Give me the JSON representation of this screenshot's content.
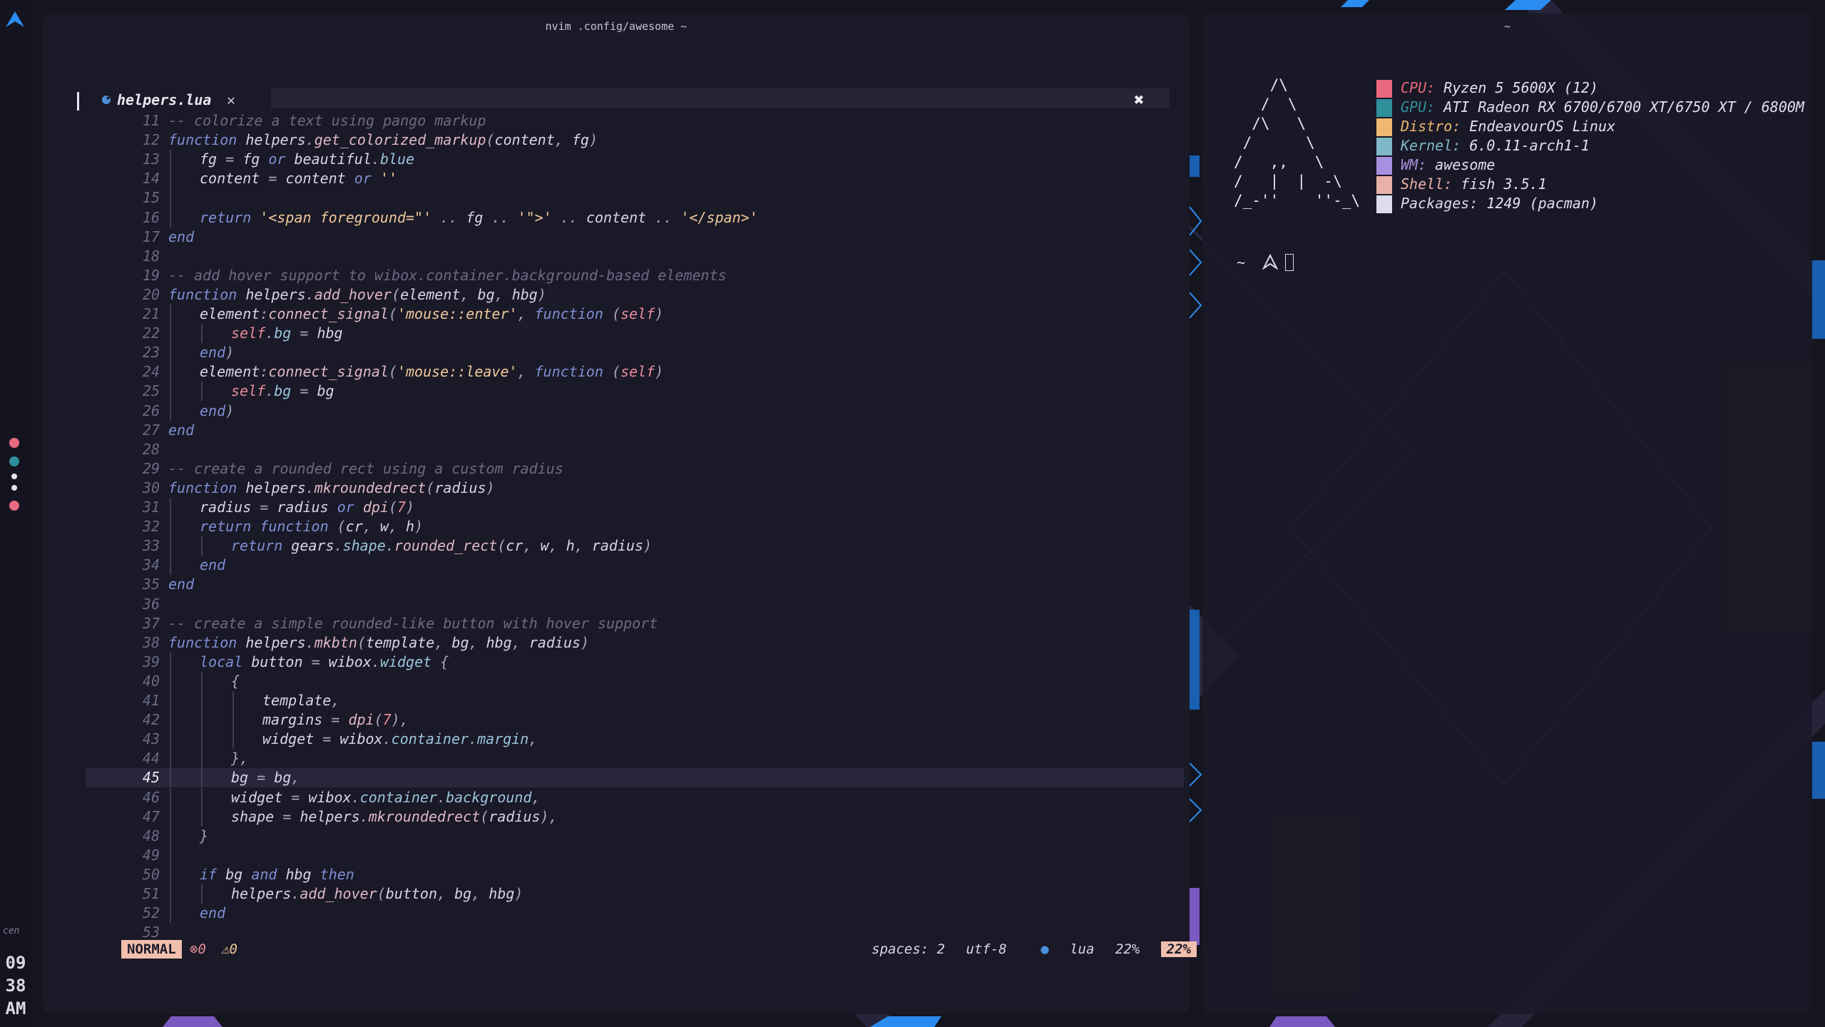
{
  "palette": {
    "accent": "#2a8cf0",
    "pink": "#e8697f",
    "teal": "#2f8f9b",
    "peach": "#f0bfae",
    "purple": "#a27be0"
  },
  "editor": {
    "title": "nvim .config/awesome ~",
    "tab_name": "helpers.lua",
    "tab_close": "✕",
    "close_all": "✖",
    "lines": [
      {
        "n": "11",
        "code": "-- colorize a text using pango markup",
        "kind": "comment",
        "indent": 0
      },
      {
        "n": "12",
        "code": "function helpers.get_colorized_markup(content, fg)",
        "kind": "fn",
        "indent": 0
      },
      {
        "n": "13",
        "code": "fg = fg or beautiful.blue",
        "kind": "code",
        "indent": 1
      },
      {
        "n": "14",
        "code": "content = content or ''",
        "kind": "code",
        "indent": 1
      },
      {
        "n": "15",
        "code": "",
        "kind": "code",
        "indent": 1
      },
      {
        "n": "16",
        "code": "return '<span foreground=\"' .. fg .. '\">' .. content .. '</span>'",
        "kind": "ret",
        "indent": 1
      },
      {
        "n": "17",
        "code": "end",
        "kind": "kw",
        "indent": 0
      },
      {
        "n": "18",
        "code": "",
        "kind": "code",
        "indent": 0
      },
      {
        "n": "19",
        "code": "-- add hover support to wibox.container.background-based elements",
        "kind": "comment",
        "indent": 0
      },
      {
        "n": "20",
        "code": "function helpers.add_hover(element, bg, hbg)",
        "kind": "fn",
        "indent": 0
      },
      {
        "n": "21",
        "code": "element:connect_signal('mouse::enter', function (self)",
        "kind": "sig",
        "indent": 1
      },
      {
        "n": "22",
        "code": "self.bg = hbg",
        "kind": "self",
        "indent": 2
      },
      {
        "n": "23",
        "code": "end)",
        "kind": "kw",
        "indent": 1
      },
      {
        "n": "24",
        "code": "element:connect_signal('mouse::leave', function (self)",
        "kind": "sig",
        "indent": 1
      },
      {
        "n": "25",
        "code": "self.bg = bg",
        "kind": "self",
        "indent": 2
      },
      {
        "n": "26",
        "code": "end)",
        "kind": "kw",
        "indent": 1
      },
      {
        "n": "27",
        "code": "end",
        "kind": "kw",
        "indent": 0
      },
      {
        "n": "28",
        "code": "",
        "kind": "code",
        "indent": 0
      },
      {
        "n": "29",
        "code": "-- create a rounded rect using a custom radius",
        "kind": "comment",
        "indent": 0
      },
      {
        "n": "30",
        "code": "function helpers.mkroundedrect(radius)",
        "kind": "fn",
        "indent": 0
      },
      {
        "n": "31",
        "code": "radius = radius or dpi(7)",
        "kind": "code",
        "indent": 1
      },
      {
        "n": "32",
        "code": "return function (cr, w, h)",
        "kind": "kw",
        "indent": 1
      },
      {
        "n": "33",
        "code": "return gears.shape.rounded_rect(cr, w, h, radius)",
        "kind": "ret2",
        "indent": 2
      },
      {
        "n": "34",
        "code": "end",
        "kind": "kw",
        "indent": 1
      },
      {
        "n": "35",
        "code": "end",
        "kind": "kw",
        "indent": 0
      },
      {
        "n": "36",
        "code": "",
        "kind": "code",
        "indent": 0
      },
      {
        "n": "37",
        "code": "-- create a simple rounded-like button with hover support",
        "kind": "comment",
        "indent": 0
      },
      {
        "n": "38",
        "code": "function helpers.mkbtn(template, bg, hbg, radius)",
        "kind": "fn",
        "indent": 0
      },
      {
        "n": "39",
        "code": "local button = wibox.widget {",
        "kind": "local",
        "indent": 1
      },
      {
        "n": "40",
        "code": "{",
        "kind": "punc",
        "indent": 2
      },
      {
        "n": "41",
        "code": "template,",
        "kind": "code",
        "indent": 3
      },
      {
        "n": "42",
        "code": "margins = dpi(7),",
        "kind": "code",
        "indent": 3
      },
      {
        "n": "43",
        "code": "widget = wibox.container.margin,",
        "kind": "code",
        "indent": 3
      },
      {
        "n": "44",
        "code": "},",
        "kind": "punc",
        "indent": 2
      },
      {
        "n": "45",
        "code": "bg = bg,",
        "kind": "code",
        "indent": 2
      },
      {
        "n": "46",
        "code": "widget = wibox.container.background,",
        "kind": "code",
        "indent": 2
      },
      {
        "n": "47",
        "code": "shape = helpers.mkroundedrect(radius),",
        "kind": "code",
        "indent": 2
      },
      {
        "n": "48",
        "code": "}",
        "kind": "punc",
        "indent": 1
      },
      {
        "n": "49",
        "code": "",
        "kind": "code",
        "indent": 1
      },
      {
        "n": "50",
        "code": "if bg and hbg then",
        "kind": "kw",
        "indent": 1
      },
      {
        "n": "51",
        "code": "helpers.add_hover(button, bg, hbg)",
        "kind": "code",
        "indent": 2
      },
      {
        "n": "52",
        "code": "end",
        "kind": "kw",
        "indent": 1
      },
      {
        "n": "53",
        "code": "",
        "kind": "code",
        "indent": 0
      }
    ],
    "cursor_line": "45",
    "status": {
      "mode": "NORMAL",
      "errors": "0",
      "warnings": "0",
      "spaces": "spaces: 2",
      "encoding": "utf-8",
      "filetype": "lua",
      "percent": "22%",
      "percent2": "22%"
    }
  },
  "terminal": {
    "title": "~",
    "ascii": "    /\\\n   /  \\\n  /\\   \\\n /      \\\n/   ,,   \\\n/   |  |  -\\\n/_-''    ''-_\\",
    "info": [
      {
        "key": "CPU:",
        "value": "Ryzen 5 5600X (12)",
        "color": "#e8697f"
      },
      {
        "key": "GPU:",
        "value": "ATI Radeon RX 6700/6700 XT/6750 XT / 6800M",
        "color": "#2f8f9b"
      },
      {
        "key": "Distro:",
        "value": "EndeavourOS Linux",
        "color": "#f0b870"
      },
      {
        "key": "Kernel:",
        "value": "6.0.11-arch1-1",
        "color": "#7fb8c8"
      },
      {
        "key": "WM:",
        "value": "awesome",
        "color": "#a890e0"
      },
      {
        "key": "Shell:",
        "value": "fish 3.5.1",
        "color": "#e8b0a8"
      },
      {
        "key": "Packages:",
        "value": "1249 (pacman)",
        "color": "#dcdcee"
      }
    ],
    "prompt": "~"
  },
  "bar": {
    "layout_label": "cen",
    "clock_hour": "09",
    "clock_min": "38",
    "clock_ampm": "AM"
  }
}
